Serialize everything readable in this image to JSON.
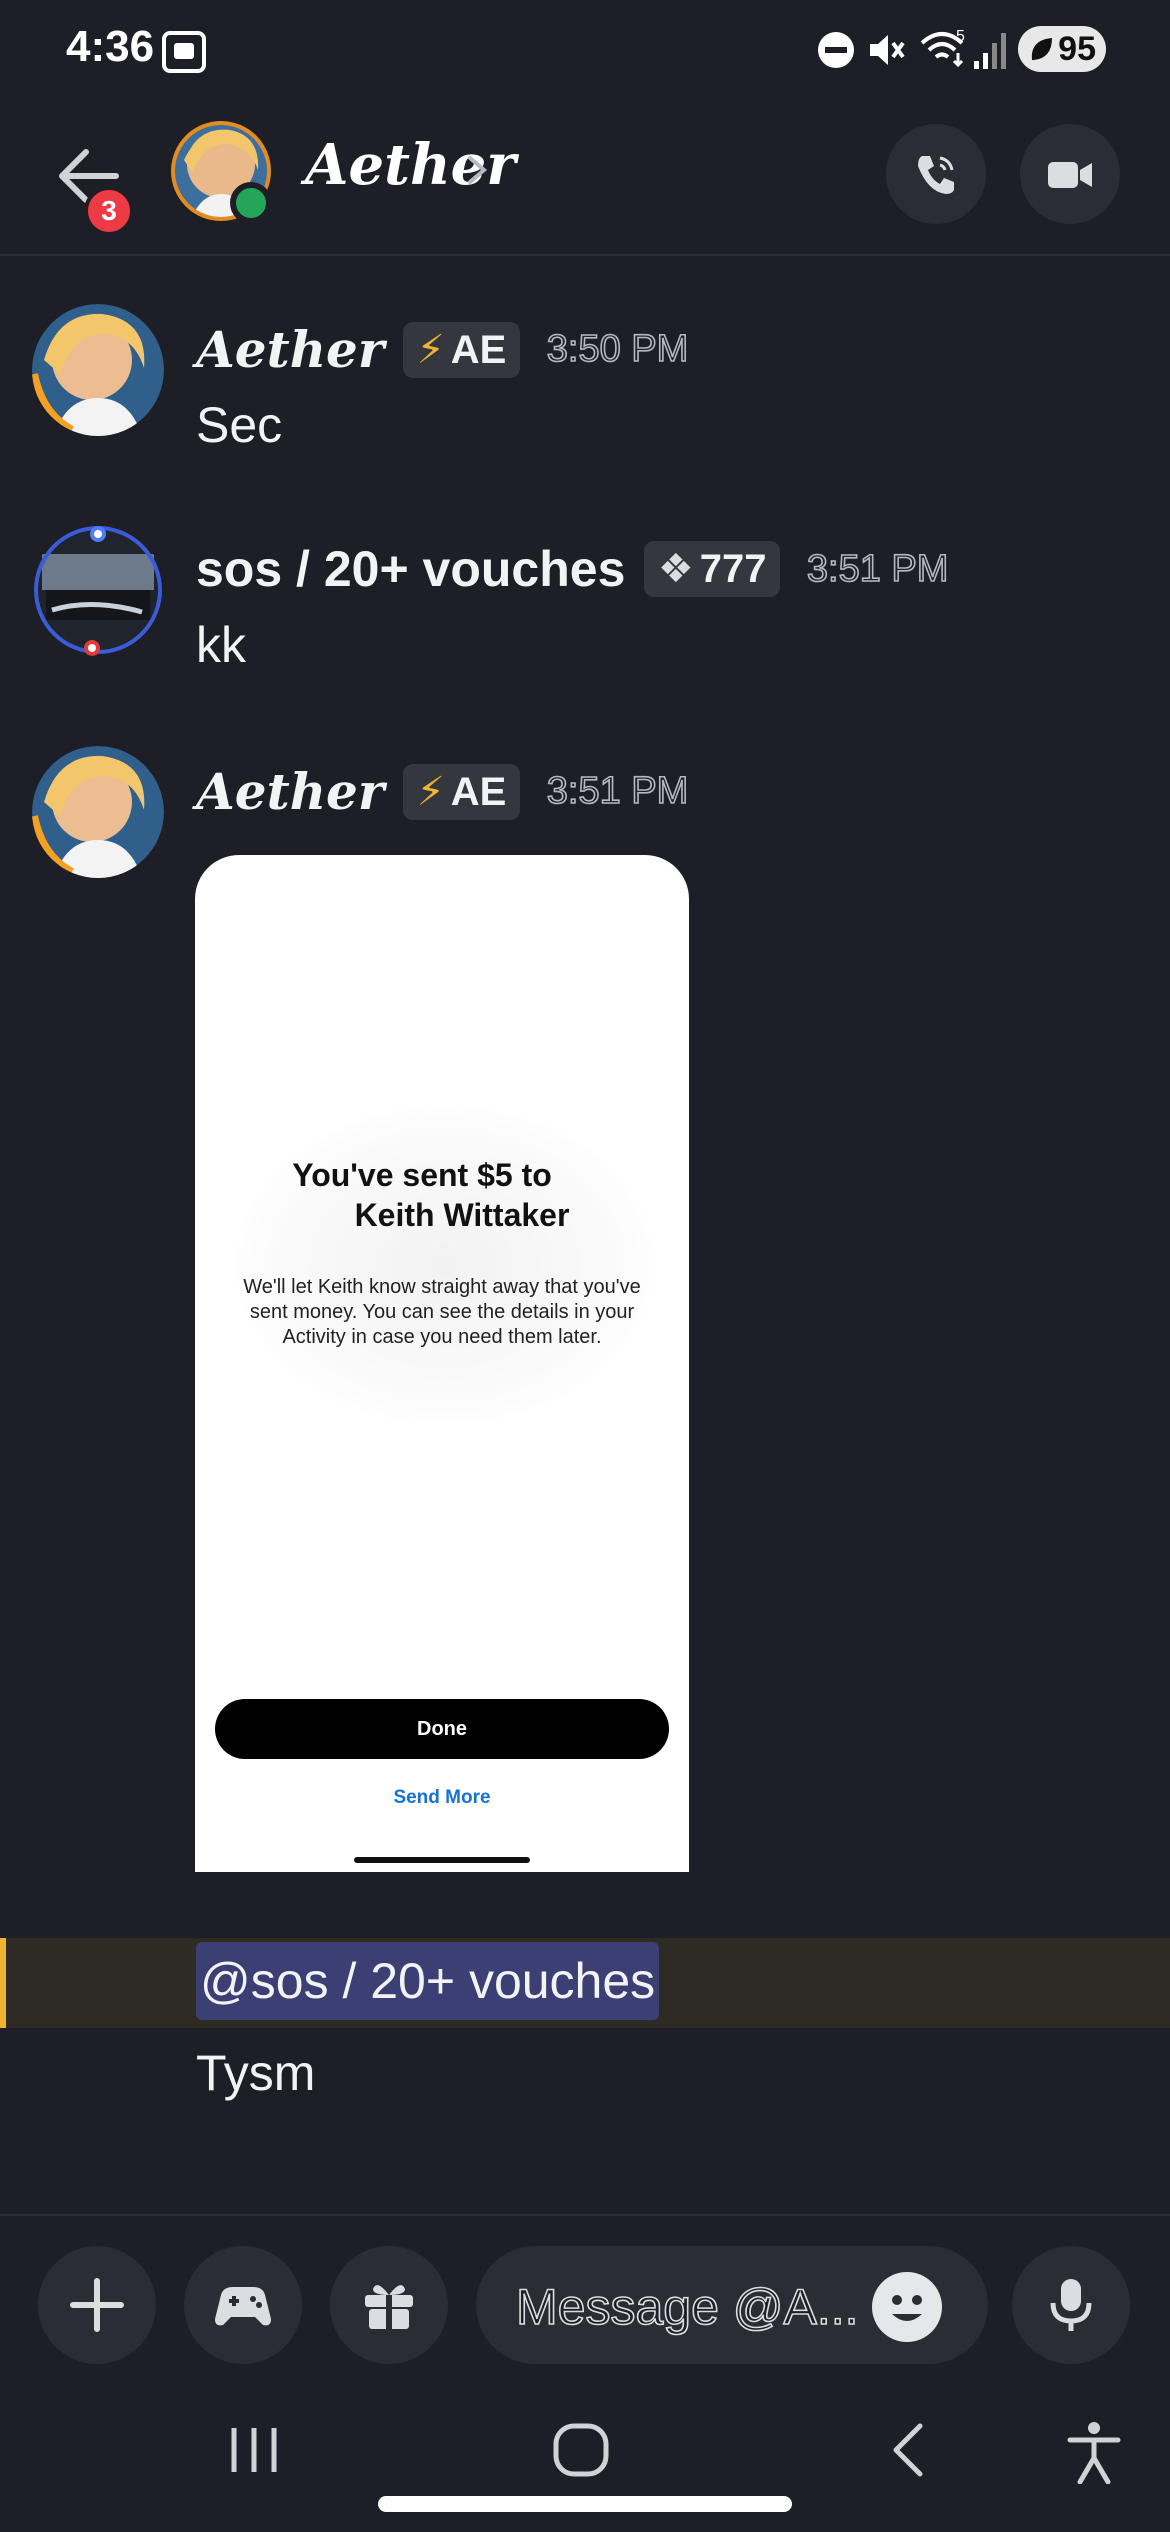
{
  "status_bar": {
    "time": "4:36",
    "battery": "95",
    "wifi_label": "5"
  },
  "header": {
    "title": "Aether",
    "unread_badge": "3"
  },
  "messages": [
    {
      "author": "Aether",
      "tag_icon": "⚡",
      "tag": "AE",
      "time": "3:50 PM",
      "text": "Sec"
    },
    {
      "author": "sos / 20+ vouches",
      "tag_icon": "❖",
      "tag": "777",
      "time": "3:51 PM",
      "text": "kk"
    },
    {
      "author": "Aether",
      "tag_icon": "⚡",
      "tag": "AE",
      "time": "3:51 PM",
      "attachment": {
        "title_line1": "You've sent $5 to",
        "title_line2": "Keith Wittaker",
        "description": "We'll let Keith know straight away that you've sent money. You can see the details in your Activity in case you need them later.",
        "done_label": "Done",
        "send_more_label": "Send More"
      }
    }
  ],
  "mention": {
    "text": "@sos / 20+ vouches"
  },
  "last_message": {
    "text": "Tysm"
  },
  "input": {
    "placeholder": "Message @A..."
  },
  "colors": {
    "background": "#1e1f26",
    "online": "#23a55a",
    "badge": "#ec3b44",
    "mention_highlight": "#2e2b24",
    "mention_bar": "#f0b232",
    "mention_pill": "#3c3f74",
    "send_more_link": "#1673d6"
  },
  "icons": {
    "status": [
      "dnd-icon",
      "mute-icon",
      "wifi-icon",
      "signal-icon",
      "battery-icon"
    ],
    "header": [
      "back-arrow-icon",
      "phone-call-icon",
      "video-camera-icon"
    ],
    "input_bar": [
      "plus-icon",
      "gamepad-icon",
      "gift-icon",
      "emoji-icon",
      "microphone-icon"
    ],
    "navigation": [
      "recent-apps-icon",
      "home-icon",
      "back-icon",
      "accessibility-icon"
    ]
  }
}
